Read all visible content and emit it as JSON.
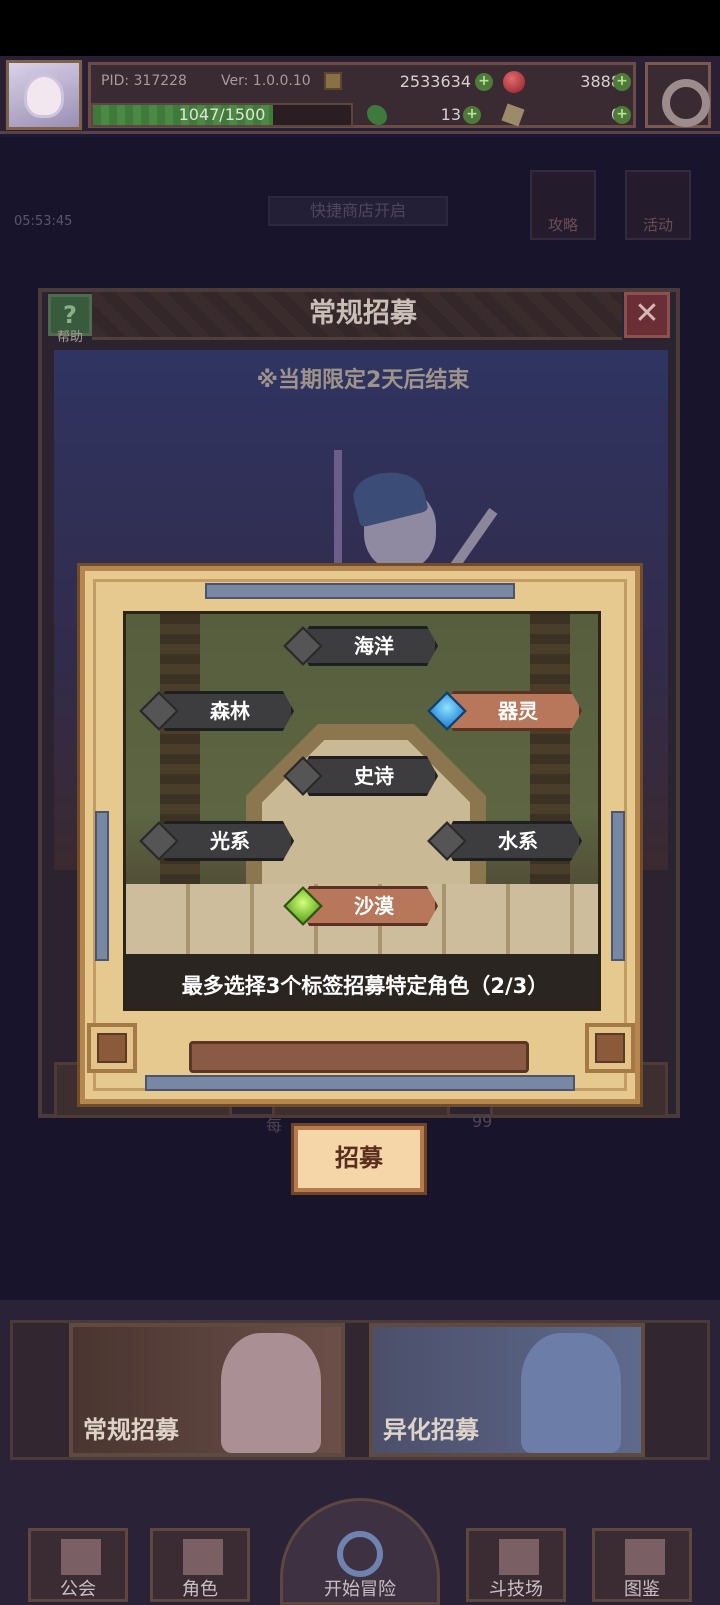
{
  "hud": {
    "pid": "PID: 317228",
    "version": "Ver: 1.0.0.10",
    "gold": "2533634",
    "gems": "3888",
    "xp_text": "1047/1500",
    "xp_progress": 0.698,
    "clovers": "13",
    "keys": "0",
    "plus_glyph": "+"
  },
  "background": {
    "timer": "05:53:45",
    "shop_banner": "快捷商店开启",
    "strategy_label": "攻略",
    "event_label": "活动"
  },
  "recruit_window": {
    "title": "常规招募",
    "help_label": "帮助",
    "help_glyph": "?",
    "close_glyph": "✕",
    "limit_notice": "※当期限定2天后结束",
    "daily_prefix": "每",
    "daily_count": "99"
  },
  "tag_dialog": {
    "tags": [
      {
        "label": "海洋",
        "selected": false,
        "gem_color": "gray"
      },
      {
        "label": "森林",
        "selected": false,
        "gem_color": "gray"
      },
      {
        "label": "器灵",
        "selected": true,
        "gem_color": "blue"
      },
      {
        "label": "史诗",
        "selected": false,
        "gem_color": "gray"
      },
      {
        "label": "光系",
        "selected": false,
        "gem_color": "gray"
      },
      {
        "label": "水系",
        "selected": false,
        "gem_color": "gray"
      },
      {
        "label": "沙漠",
        "selected": true,
        "gem_color": "green"
      }
    ],
    "status": "最多选择3个标签招募特定角色（2/3）",
    "selected_count": 2,
    "max_count": 3
  },
  "recruit_button": "招募",
  "pools": {
    "regular": "常规招募",
    "alien": "异化招募"
  },
  "nav": {
    "guild": "公会",
    "character": "角色",
    "adventure": "开始冒险",
    "arena": "斗技场",
    "codex": "图鉴"
  },
  "colors": {
    "selected_tag": "#b8775a",
    "unselected_tag": "#3d3d3f",
    "dialog_frame": "#e6c98f",
    "recruit_button": "#f5d6a8"
  }
}
